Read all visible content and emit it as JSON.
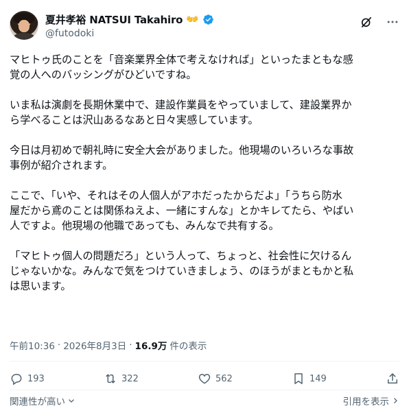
{
  "author": {
    "display_name": "夏井孝裕 NATSUI Takahiro",
    "emoji": "👐",
    "handle": "@futodoki"
  },
  "tweet": {
    "paragraphs": [
      "マヒトゥ氏のことを「音楽業界全体で考えなければ」といったまともな感\n覚の人へのバッシングがひどいですね。",
      "いま私は演劇を長期休業中で、建設作業員をやっていまして、建設業界か\nら学べることは沢山あるなあと日々実感しています。",
      "今日は月初めで朝礼時に安全大会がありました。他現場のいろいろな事故\n事例が紹介されます。",
      "ここで、「いや、それはその人個人がアホだったからだよ」「うちら防水\n屋だから鳶のことは関係ねえよ、一緒にすんな」とかキレてたら、やばい\n人ですよ。他現場の他職であっても、みんなで共有する。",
      "「マヒトゥ個人の問題だろ」という人って、ちょっと、社会性に欠けるん\nじゃないかな。みんなで気をつけていきましょう、のほうがまともかと私\nは思います。"
    ],
    "time": "午前10:36",
    "date": "2026年8月3日",
    "views_count": "16.9万",
    "views_label": "件の表示",
    "separator": "·"
  },
  "actions": {
    "reply_count": "193",
    "retweet_count": "322",
    "like_count": "562",
    "bookmark_count": "149"
  },
  "footer": {
    "sort_label": "関連性が高い",
    "quote_label": "引用を表示"
  },
  "colors": {
    "text": "#0f1419",
    "secondary": "#536471",
    "verified": "#1d9bf0",
    "divider": "#eff3f4"
  }
}
